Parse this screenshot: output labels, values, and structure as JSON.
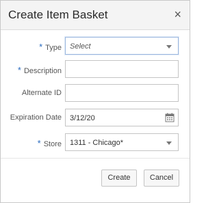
{
  "dialog": {
    "title": "Create Item Basket",
    "close_glyph": "×"
  },
  "fields": {
    "type": {
      "required_mark": "*",
      "label": "Type",
      "value": "Select",
      "is_placeholder": true
    },
    "description": {
      "required_mark": "*",
      "label": "Description",
      "value": ""
    },
    "alternate_id": {
      "label": "Alternate ID",
      "value": ""
    },
    "expiration_date": {
      "label": "Expiration Date",
      "value": "3/12/20"
    },
    "store": {
      "required_mark": "*",
      "label": "Store",
      "value": "1311 - Chicago*"
    }
  },
  "buttons": {
    "create": "Create",
    "cancel": "Cancel"
  },
  "icons": {
    "close": "close-icon",
    "dropdown": "chevron-down-icon",
    "calendar": "calendar-icon"
  },
  "colors": {
    "required": "#2a6bbf",
    "focus_border": "#9bb7de"
  }
}
